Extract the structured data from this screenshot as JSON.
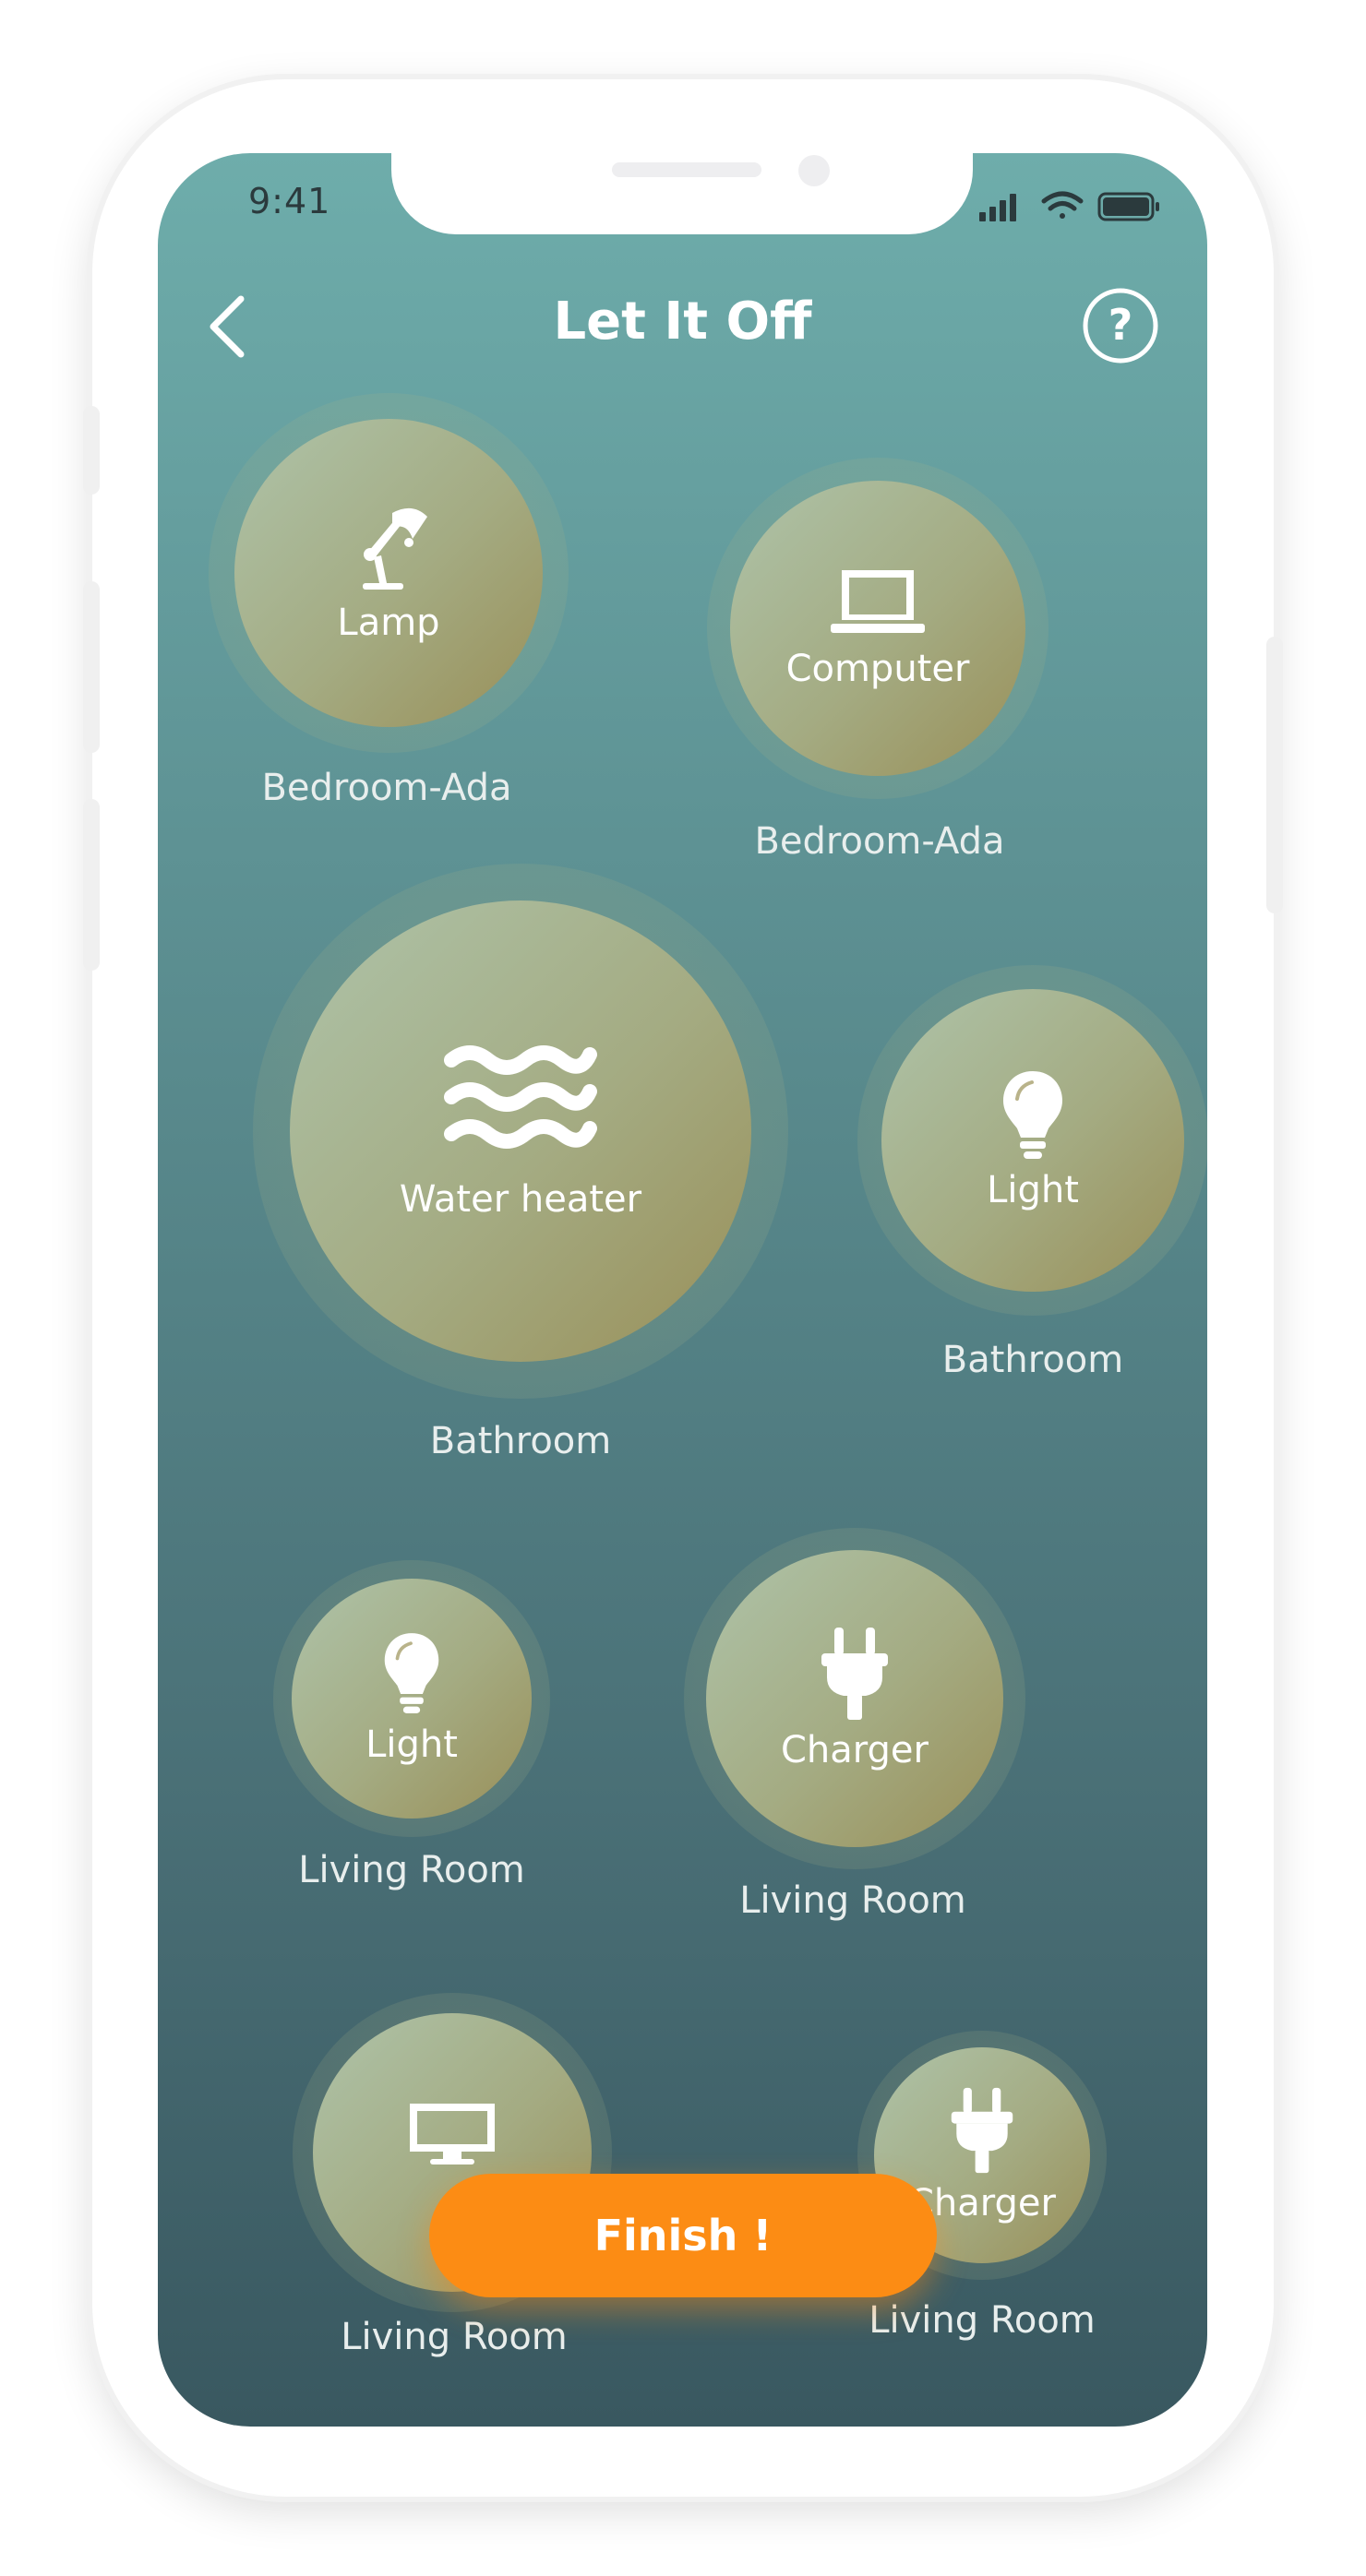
{
  "status_bar": {
    "time": "9:41"
  },
  "header": {
    "title": "Let It Off"
  },
  "devices": [
    {
      "name": "Lamp",
      "room": "Bedroom-Ada",
      "icon": "lamp-icon"
    },
    {
      "name": "Computer",
      "room": "Bedroom-Ada",
      "icon": "laptop-icon"
    },
    {
      "name": "Water heater",
      "room": "Bathroom",
      "icon": "waves-icon"
    },
    {
      "name": "Light",
      "room": "Bathroom",
      "icon": "lightbulb-icon"
    },
    {
      "name": "Light",
      "room": "Living Room",
      "icon": "lightbulb-icon"
    },
    {
      "name": "Charger",
      "room": "Living Room",
      "icon": "plug-icon"
    },
    {
      "name": "",
      "room": "Living Room",
      "icon": "monitor-icon"
    },
    {
      "name": "Charger",
      "room": "Living Room",
      "icon": "plug-icon"
    }
  ],
  "finish_button": {
    "label": "Finish !",
    "color": "#fc8c14"
  },
  "colors": {
    "gradient_top": "#6eadab",
    "gradient_bottom": "#395860",
    "bubble": "#a4ab82"
  }
}
